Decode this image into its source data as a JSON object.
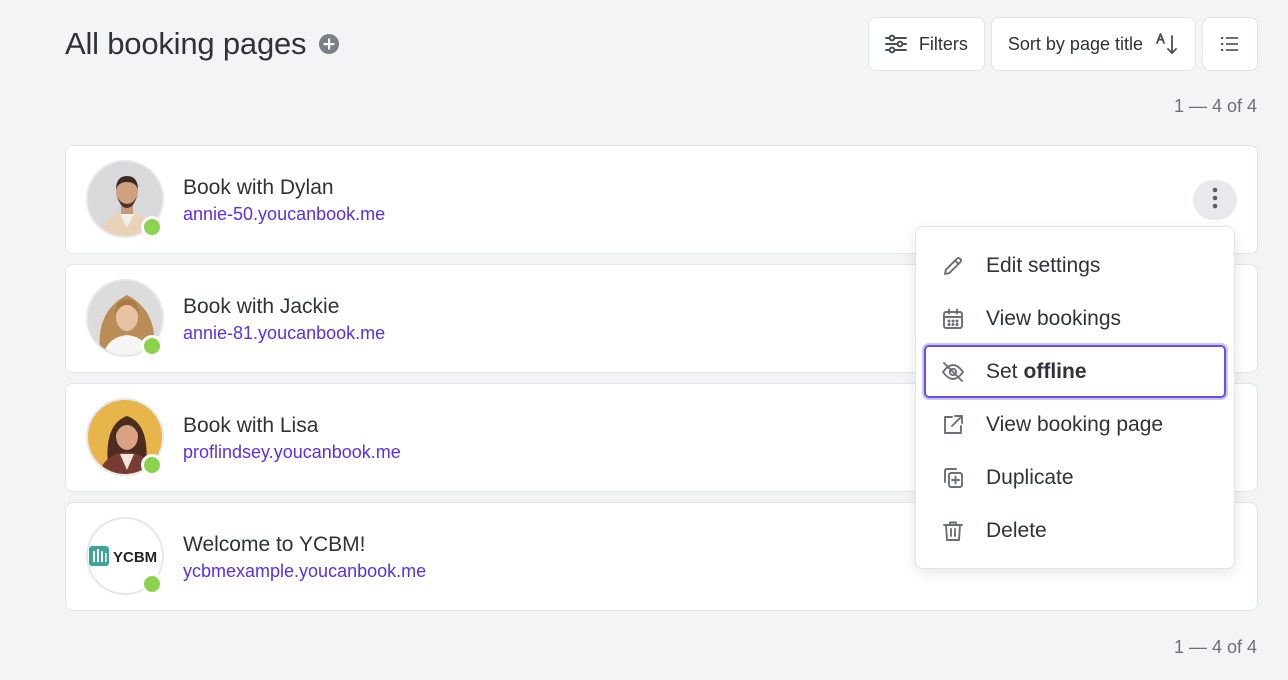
{
  "header": {
    "title": "All booking pages",
    "add_icon": "plus-circle-icon"
  },
  "toolbar": {
    "filters_label": "Filters",
    "filters_icon": "sliders-icon",
    "sort_label": "Sort by page title",
    "sort_icon": "sort-alpha-icon",
    "view_icon": "list-view-icon"
  },
  "pager": {
    "top": "1 — 4 of 4",
    "bottom": "1 — 4 of 4"
  },
  "pages": [
    {
      "title": "Book with Dylan",
      "url": "annie-50.youcanbook.me",
      "status": "online"
    },
    {
      "title": "Book with Jackie",
      "url": "annie-81.youcanbook.me",
      "status": "online"
    },
    {
      "title": "Book with Lisa",
      "url": "proflindsey.youcanbook.me",
      "status": "online"
    },
    {
      "title": "Welcome to YCBM!",
      "url": "ycbmexample.youcanbook.me",
      "status": "online",
      "logo_text": "YCBM"
    }
  ],
  "menu": {
    "items": [
      {
        "label": "Edit settings",
        "icon": "pencil-icon"
      },
      {
        "label": "View bookings",
        "icon": "calendar-icon"
      },
      {
        "label": "Set",
        "label_bold": "offline",
        "icon": "eye-off-icon"
      },
      {
        "label": "View booking page",
        "icon": "external-link-icon"
      },
      {
        "label": "Duplicate",
        "icon": "duplicate-icon"
      },
      {
        "label": "Delete",
        "icon": "trash-icon"
      }
    ]
  },
  "colors": {
    "accent": "#5b2ee8",
    "status_online": "#8bd34d",
    "focus_ring": "#6a4ee8"
  }
}
